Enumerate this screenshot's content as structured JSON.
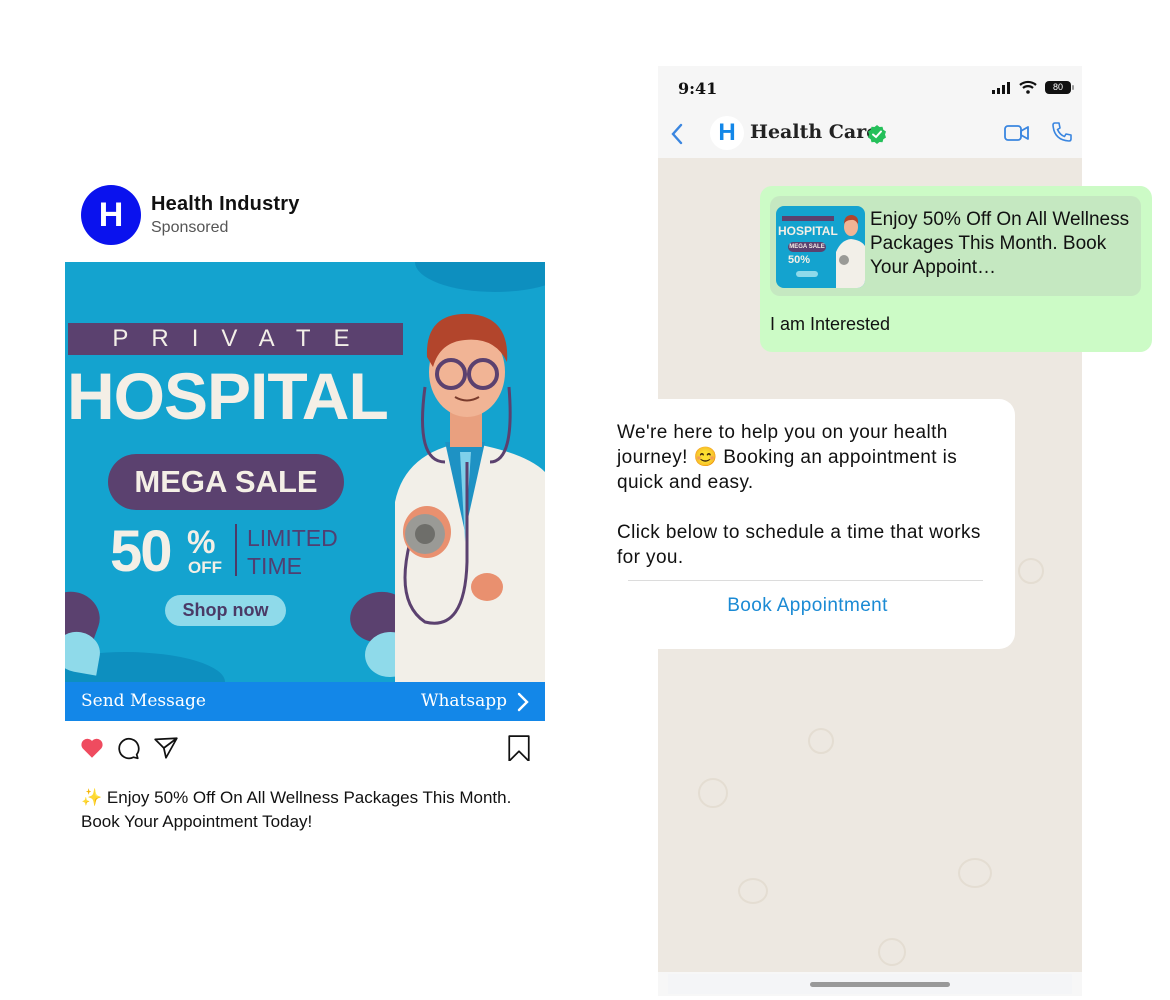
{
  "post": {
    "account": {
      "avatar_letter": "H",
      "name": "Health Industry",
      "subtitle": "Sponsored"
    },
    "ad": {
      "tagline": "PRIVATE",
      "headline": "HOSPITAL",
      "sale_label": "MEGA SALE",
      "discount_number": "50",
      "discount_sign": "%",
      "discount_off": "OFF",
      "limited_line1": "LIMITED",
      "limited_line2": "TIME",
      "shop_button": "Shop now"
    },
    "cta": {
      "left_label": "Send Message",
      "right_label": "Whatsapp"
    },
    "actions": [
      "heart-icon",
      "comment-icon",
      "share-icon",
      "bookmark-icon"
    ],
    "caption": {
      "emoji": "✨",
      "text": "Enjoy 50% Off On All Wellness Packages This Month. Book Your Appointment Today!"
    }
  },
  "phone": {
    "status_bar": {
      "time": "9:41",
      "battery": "80"
    },
    "chat_header": {
      "avatar_letter": "H",
      "contact_name": "Health Care",
      "verified": true
    },
    "messages": {
      "outgoing": {
        "quoted_thumb_headline": "HOSPITAL",
        "quoted_thumb_sale": "MEGA SALE",
        "quoted_thumb_pct": "50%",
        "quoted_text": "Enjoy 50% Off On All Wellness Packages This Month. Book Your Appoint…",
        "text": "I am Interested"
      },
      "incoming": {
        "text": "We're here to help you on your health journey! 😊  Booking an appointment is quick and easy.\n\nClick below to schedule a time that works for you.",
        "button": "Book Appointment"
      }
    }
  },
  "colors": {
    "avatar_blue": "#0a12ee",
    "cta_blue": "#1387e8",
    "ad_bg": "#14a3cf",
    "ad_purple": "#5b416f",
    "heart_red": "#ef4b5f",
    "outgoing_bubble": "#ccfbc6",
    "chat_bg": "#ede8e1",
    "link_blue": "#1a8ad4",
    "verified_green": "#25c05a"
  }
}
